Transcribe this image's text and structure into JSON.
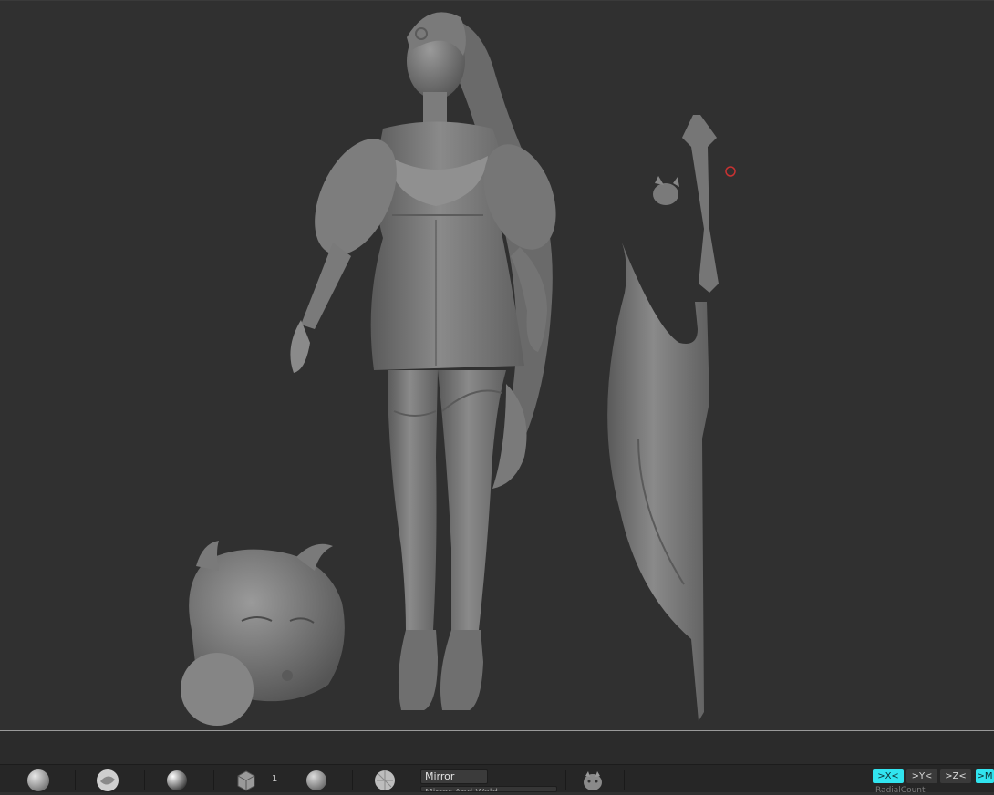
{
  "viewport": {
    "background": "#303030",
    "models": [
      "female-character-sculpt",
      "horned-pet-creature-sculpt",
      "scythe-weapon-sculpt",
      "small-creature-head-sculpt"
    ],
    "cursor_indicator": "brush-cursor-icon"
  },
  "shelf": {
    "brush_icons": [
      "sphere-brush-icon",
      "standard-brush-icon",
      "material-sphere-icon",
      "mesh-tool-icon",
      "smooth-sphere-icon",
      "texture-sphere-icon"
    ],
    "subtool_count": "1",
    "mirror_label": "Mirror",
    "mirror_sub_label": "Mirror And Weld",
    "thumbnail_icon": "creature-thumbnail-icon",
    "axis_buttons": [
      {
        "label": ">X<",
        "active": true
      },
      {
        "label": ">Y<",
        "active": false
      },
      {
        "label": ">Z<",
        "active": false
      },
      {
        "label": ">M",
        "active": true
      }
    ],
    "radial_label": "RadialCount",
    "colors": {
      "active_axis": "#31e4ef",
      "shelf_bg": "#262626"
    }
  }
}
